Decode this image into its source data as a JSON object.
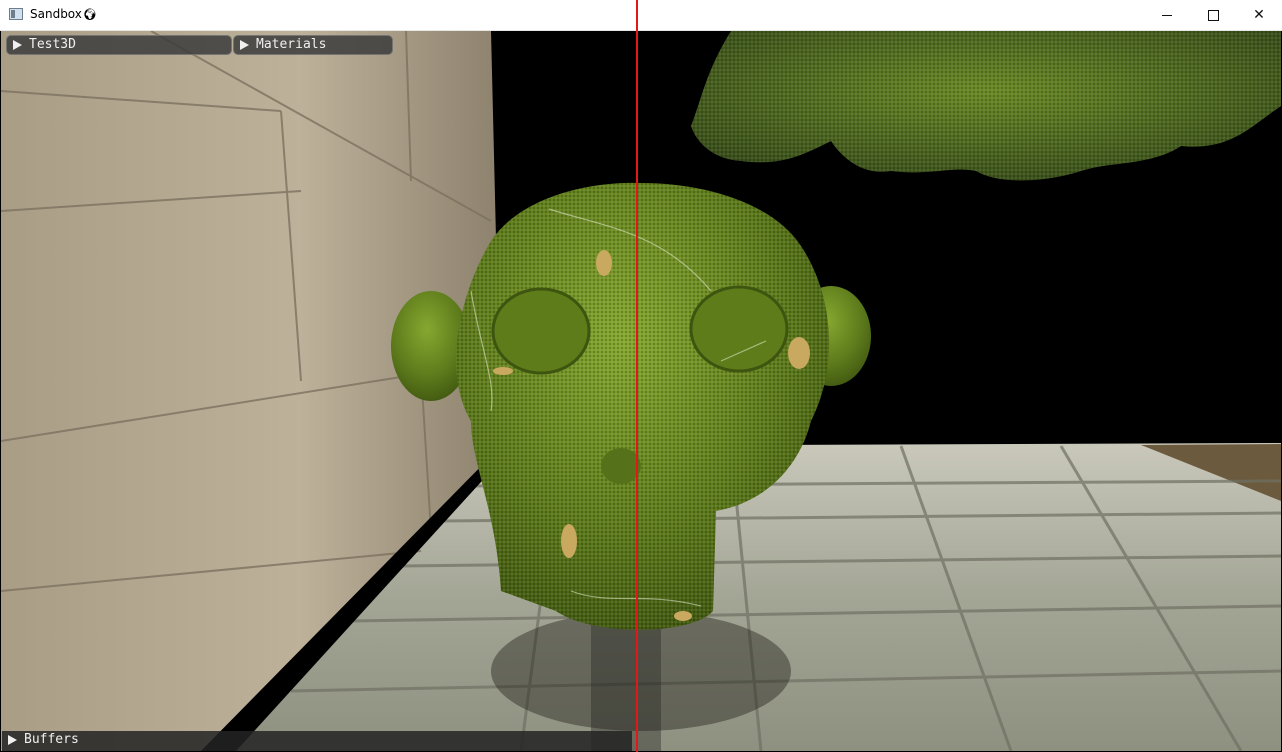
{
  "window": {
    "title": "Sandbox",
    "title_icon": "globe-icon",
    "controls": {
      "minimize": "—",
      "maximize": "□",
      "close": "✕"
    }
  },
  "panels": {
    "test3d": {
      "label": "Test3D",
      "state": "collapsed"
    },
    "materials": {
      "label": "Materials",
      "state": "collapsed"
    },
    "buffers": {
      "label": "Buffers",
      "state": "collapsed"
    }
  },
  "scene": {
    "background": "#000000",
    "objects": [
      "stone-wall",
      "stone-floor",
      "monkey-head-model",
      "leaf-canopy"
    ],
    "colors": {
      "wall": "#b3a790",
      "floor": "#a7a89a",
      "monkey": "#6b8a22",
      "leaves": "#4f6a1c",
      "split_line": "#e01818"
    }
  }
}
